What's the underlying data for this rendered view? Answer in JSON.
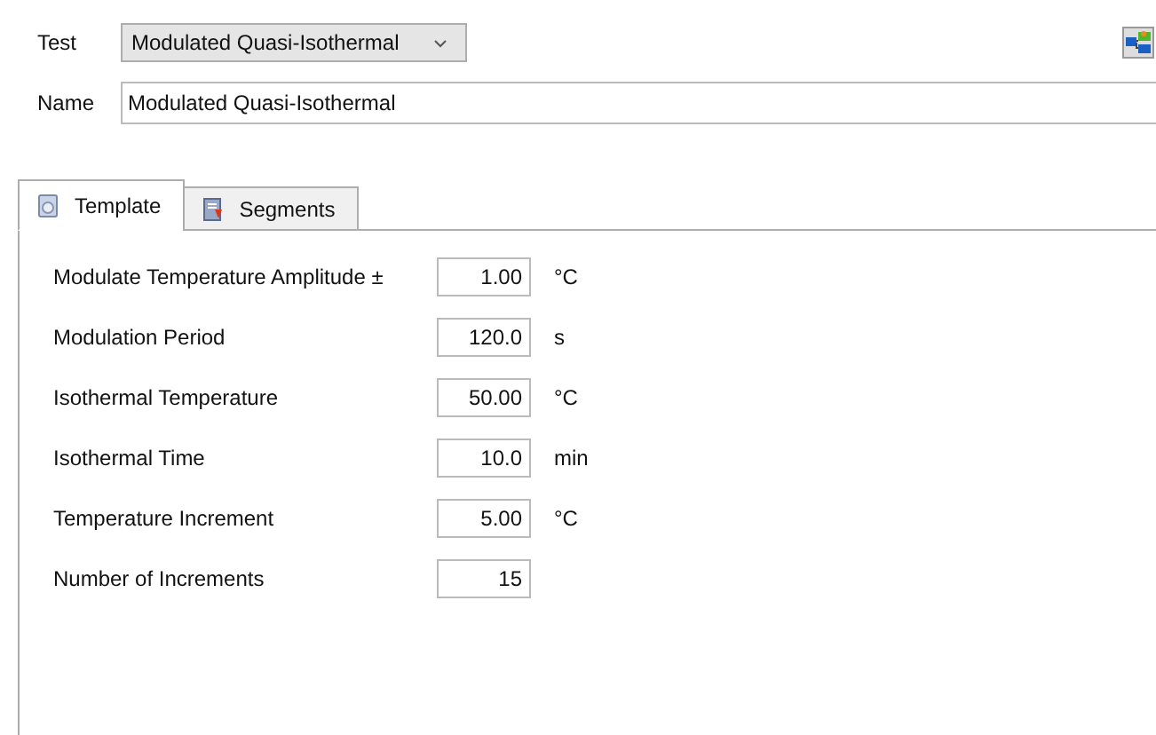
{
  "test": {
    "label": "Test",
    "value": "Modulated Quasi-Isothermal"
  },
  "name": {
    "label": "Name",
    "value": "Modulated Quasi-Isothermal"
  },
  "tabs": [
    {
      "label": "Template",
      "selected": true,
      "kind": "template"
    },
    {
      "label": "Segments",
      "selected": false,
      "kind": "segments"
    }
  ],
  "fields": [
    {
      "label": "Modulate Temperature Amplitude ±",
      "value": "1.00",
      "unit": "°C"
    },
    {
      "label": "Modulation Period",
      "value": "120.0",
      "unit": "s"
    },
    {
      "label": "Isothermal Temperature",
      "value": "50.00",
      "unit": "°C"
    },
    {
      "label": "Isothermal Time",
      "value": "10.0",
      "unit": "min"
    },
    {
      "label": "Temperature Increment",
      "value": "5.00",
      "unit": "°C"
    },
    {
      "label": "Number of Increments",
      "value": "15"
    }
  ]
}
